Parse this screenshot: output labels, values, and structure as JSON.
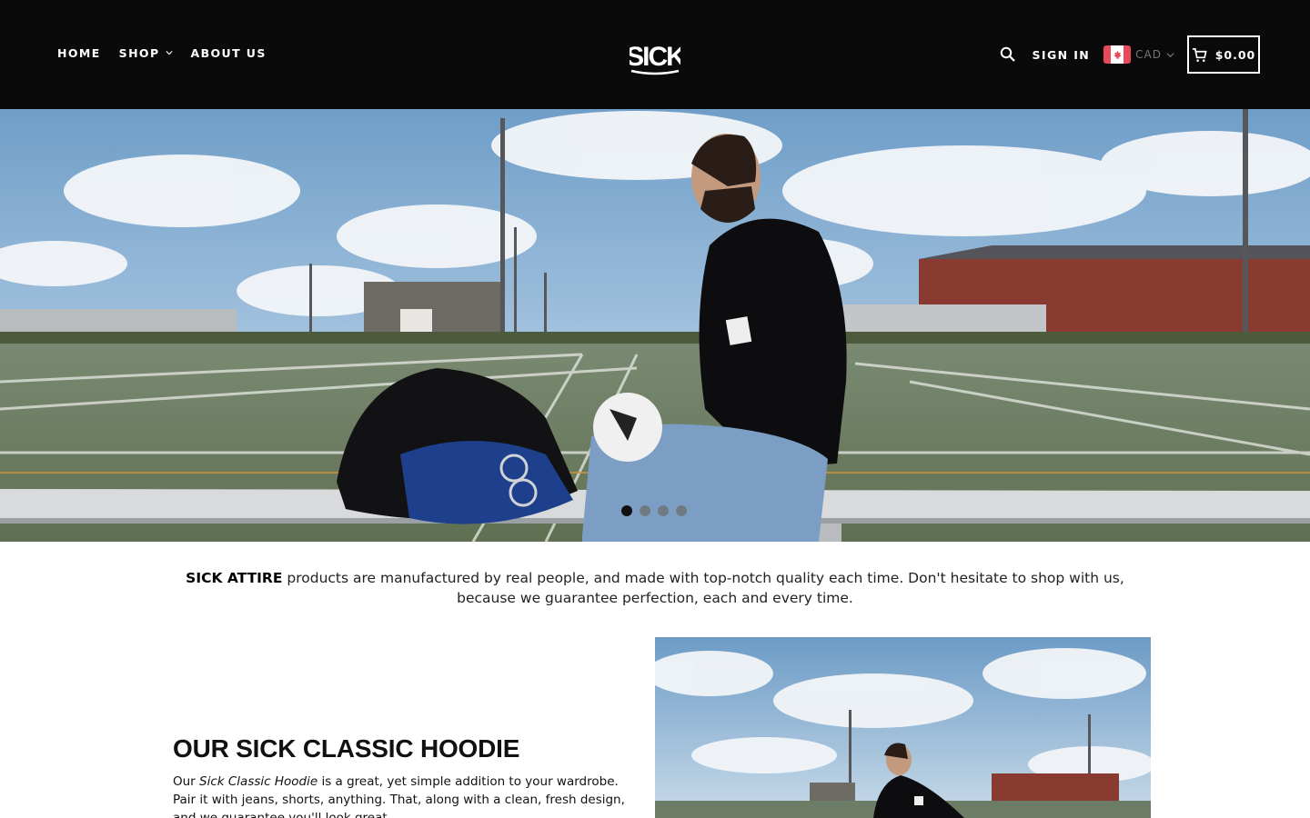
{
  "header": {
    "nav": [
      {
        "label": "HOME"
      },
      {
        "label": "SHOP"
      },
      {
        "label": "ABOUT US"
      }
    ],
    "logo_text": "SICK",
    "signin_label": "SIGN IN",
    "currency_code": "CAD",
    "cart_total": "$0.00",
    "icons": [
      "search-icon",
      "canada-flag-icon",
      "cart-icon",
      "chevron-down-icon"
    ]
  },
  "hero": {
    "slides_count": 4,
    "active_slide": 1
  },
  "intro": {
    "brand": "SICK ATTIRE",
    "text": " products are manufactured by real people, and made with top-notch quality each time. Don't hesitate to shop with us, because we guarantee perfection, each and every time."
  },
  "feature": {
    "title": "OUR SICK CLASSIC HOODIE",
    "text_before": "Our ",
    "text_italic": "Sick Classic Hoodie",
    "text_after": " is a great, yet simple addition to your wardrobe. Pair it with jeans, shorts, anything. That, along with a clean, fresh design, and we guarantee you'll look great."
  },
  "colors": {
    "header_bg": "#0a0a0a",
    "text": "#111111",
    "flag_red": "#e8495a"
  }
}
